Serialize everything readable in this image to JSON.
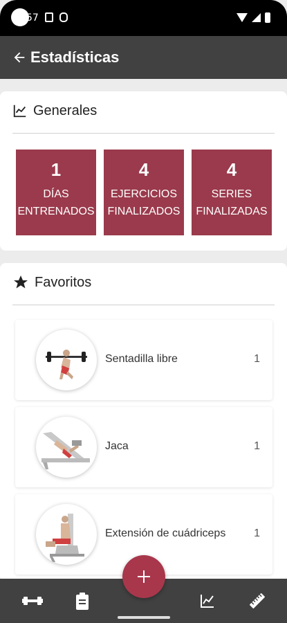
{
  "status_bar": {
    "time": "57"
  },
  "app_bar": {
    "title": "Estadísticas",
    "back_icon": "arrow-left-icon"
  },
  "generales": {
    "title": "Generales",
    "icon": "line-chart-icon",
    "accent_color": "#9a3a4c",
    "stats": [
      {
        "value": "1",
        "label": "DÍAS\nENTRENADOS"
      },
      {
        "value": "4",
        "label": "EJERCICIOS\nFINALIZADOS"
      },
      {
        "value": "4",
        "label": "SERIES\nFINALIZADAS"
      }
    ]
  },
  "favoritos": {
    "title": "Favoritos",
    "icon": "star-icon",
    "items": [
      {
        "name": "Sentadilla libre",
        "count": "1"
      },
      {
        "name": "Jaca",
        "count": "1"
      },
      {
        "name": "Extensión de cuádriceps",
        "count": "1"
      }
    ]
  },
  "bottom_nav": {
    "items": [
      "dumbbell-icon",
      "clipboard-icon",
      "add-icon",
      "chart-icon",
      "ruler-icon"
    ],
    "fab_color": "#a8374c"
  }
}
